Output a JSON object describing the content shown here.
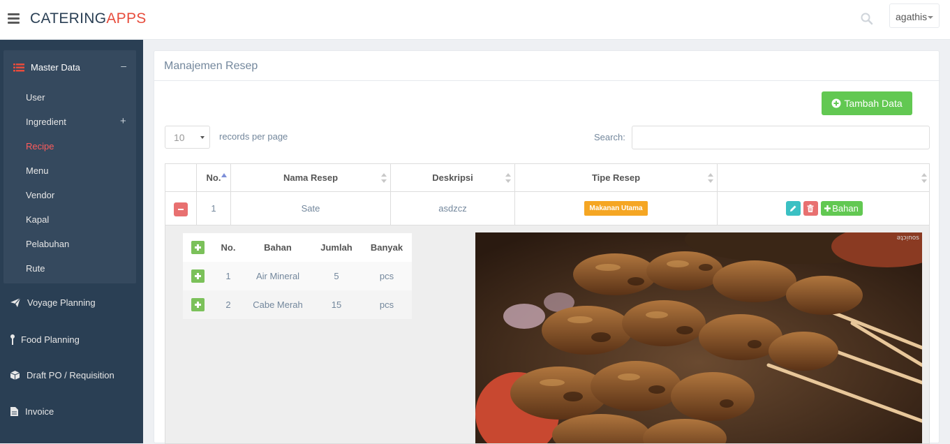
{
  "app": {
    "brand_main": "CATERING",
    "brand_accent": "APPS"
  },
  "topbar": {
    "user": "agathis"
  },
  "sidebar": {
    "section": {
      "label": "Master Data",
      "toggle": "–"
    },
    "subitems": [
      {
        "label": "User"
      },
      {
        "label": "Ingredient",
        "toggle": "+"
      },
      {
        "label": "Recipe"
      },
      {
        "label": "Menu"
      },
      {
        "label": "Vendor"
      },
      {
        "label": "Kapal"
      },
      {
        "label": "Pelabuhan"
      },
      {
        "label": "Rute"
      }
    ],
    "active": "Recipe",
    "nav": [
      {
        "label": "Voyage Planning",
        "icon": "paper-plane-icon"
      },
      {
        "label": "Food Planning",
        "icon": "map-pin-icon"
      },
      {
        "label": "Draft PO / Requisition",
        "icon": "cube-icon"
      },
      {
        "label": "Invoice",
        "icon": "file-icon"
      }
    ]
  },
  "main": {
    "title": "Manajemen Resep",
    "add_button": "Tambah Data",
    "length_value": "10",
    "length_label": "records per page",
    "search_label": "Search:",
    "search_value": "",
    "columns": [
      "No.",
      "Nama Resep",
      "Deskripsi",
      "Tipe Resep",
      ""
    ],
    "rows": [
      {
        "no": "1",
        "nama": "Sate",
        "deskripsi": "asdzcz",
        "tipe": "Makanan Utama",
        "bahan_button": "Bahan"
      }
    ],
    "detail": {
      "columns": [
        "No.",
        "Bahan",
        "Jumlah",
        "Banyak"
      ],
      "rows": [
        {
          "no": "1",
          "bahan": "Air Mineral",
          "jumlah": "5",
          "banyak": "pcs"
        },
        {
          "no": "2",
          "bahan": "Cabe Merah",
          "jumlah": "15",
          "banyak": "pcs"
        }
      ],
      "photo_watermark": "ǝʇɔᴉnos"
    }
  },
  "colors": {
    "sidebar": "#2a3f54",
    "accent_red": "#e74c3c",
    "green": "#62c852",
    "badge": "#f5a623",
    "info": "#3bc0c3",
    "danger": "#e87070"
  }
}
